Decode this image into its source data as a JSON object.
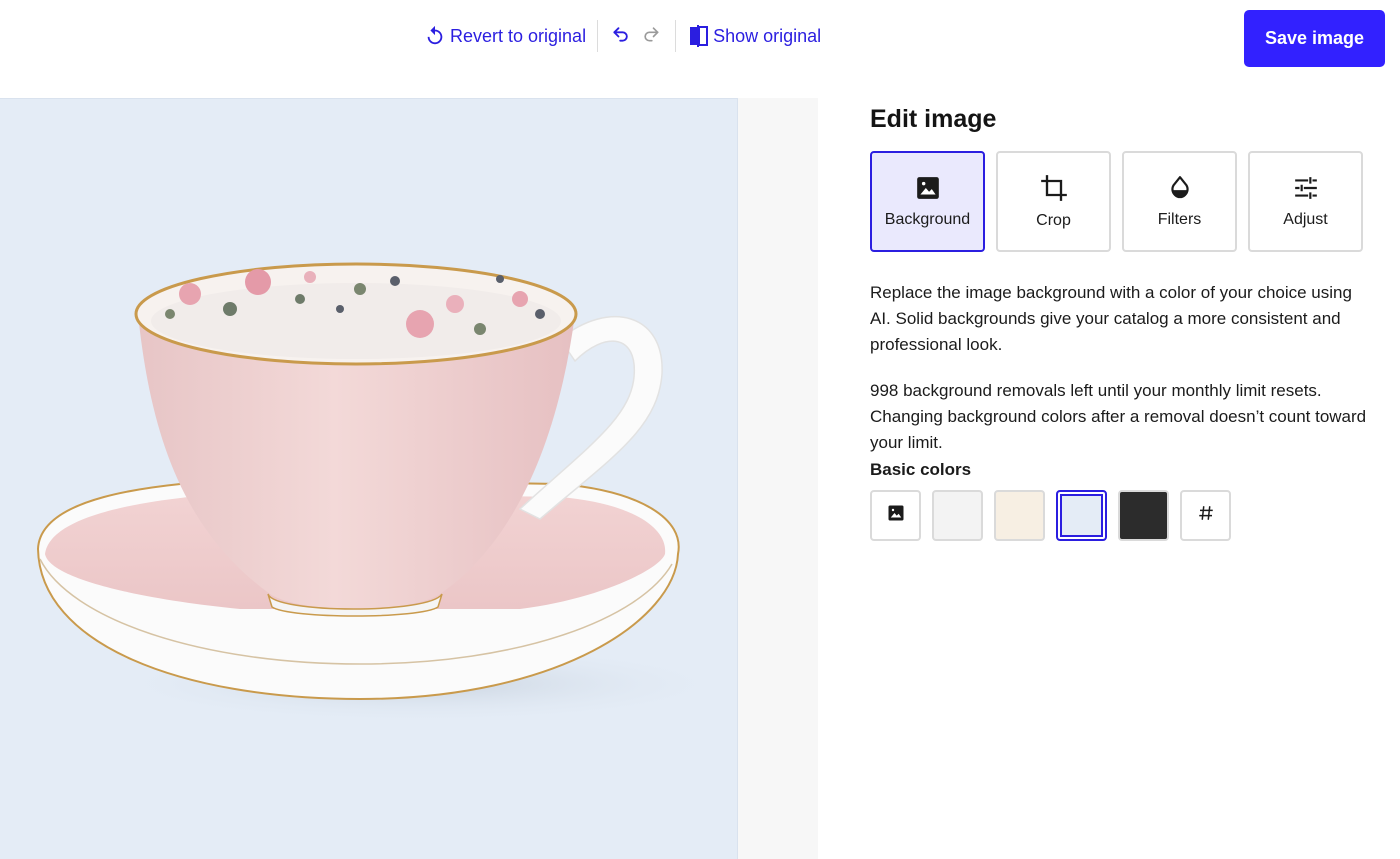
{
  "toolbar": {
    "revert_label": "Revert to original",
    "show_original_label": "Show original",
    "save_label": "Save image",
    "accent": "#3221ff"
  },
  "panel": {
    "title": "Edit image",
    "tabs": [
      {
        "label": "Background",
        "icon": "image-icon",
        "active": true
      },
      {
        "label": "Crop",
        "icon": "crop-icon",
        "active": false
      },
      {
        "label": "Filters",
        "icon": "filters-drop-icon",
        "active": false
      },
      {
        "label": "Adjust",
        "icon": "sliders-icon",
        "active": false
      }
    ],
    "description": "Replace the image background with a color of your choice using AI. Solid backgrounds give your catalog a more consistent and professional look.",
    "limit_text": "998 background removals left until your monthly limit resets. Changing background colors after a removal doesn’t count toward your limit.",
    "basic_colors_heading": "Basic colors",
    "swatches": [
      {
        "name": "original-image",
        "icon": "image-icon"
      },
      {
        "name": "light-gray",
        "color": "#f3f3f3"
      },
      {
        "name": "cream",
        "color": "#f7efe3"
      },
      {
        "name": "light-blue",
        "color": "#e4ecf6",
        "selected": true
      },
      {
        "name": "charcoal",
        "color": "#2c2c2c"
      },
      {
        "name": "custom-hex",
        "icon": "hash-icon"
      }
    ]
  },
  "canvas": {
    "background_color": "#e4ecf6",
    "subject": "teacup-and-saucer"
  }
}
